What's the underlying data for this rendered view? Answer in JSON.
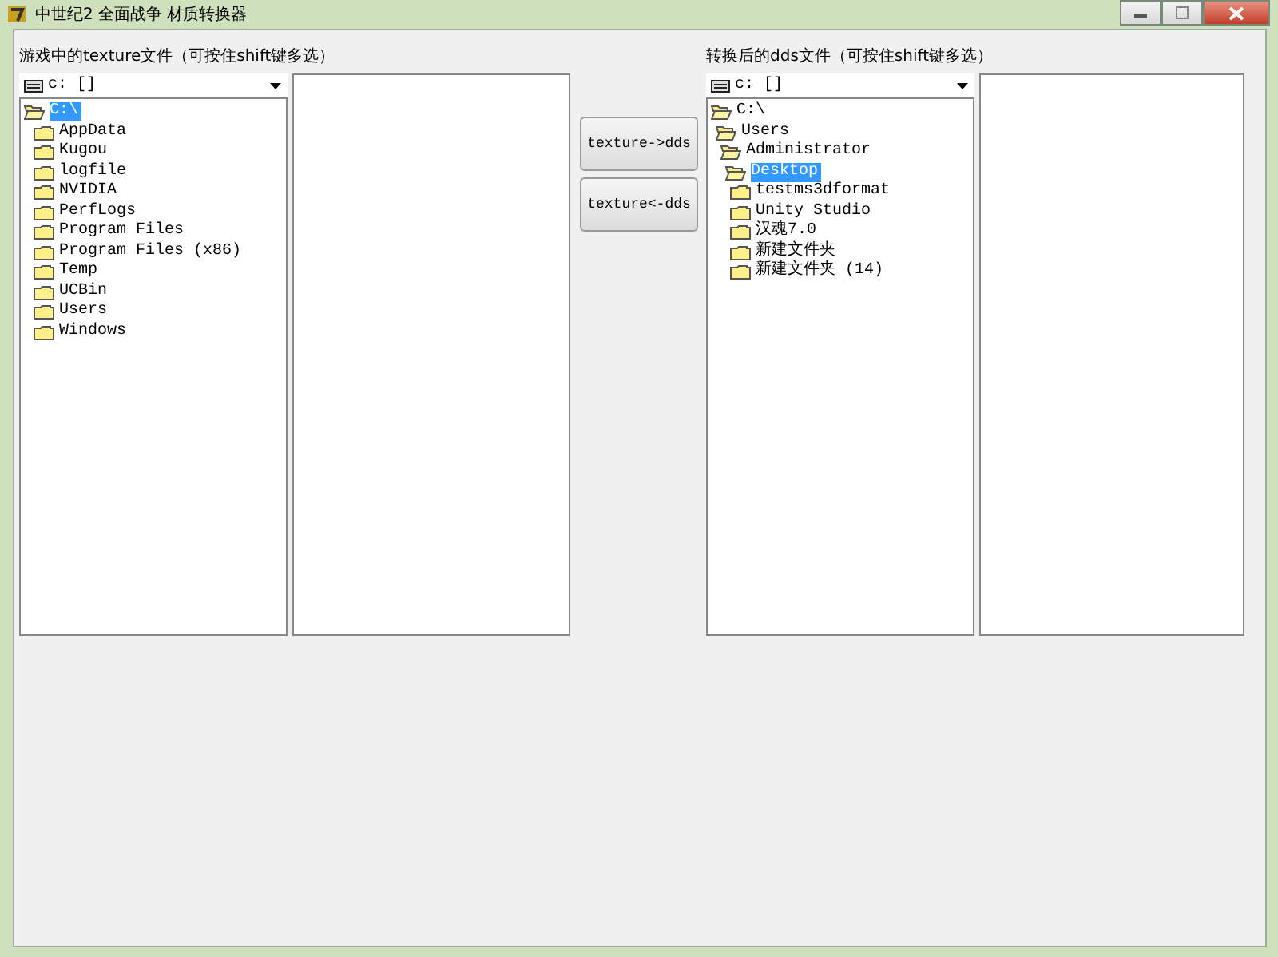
{
  "window": {
    "title": "中世纪2 全面战争 材质转换器"
  },
  "left": {
    "label": "游戏中的texture文件（可按住shift键多选）",
    "drive": "c: []",
    "tree": [
      {
        "name": "C:\\",
        "expanded": true,
        "selected": true,
        "children": [
          {
            "name": "AppData",
            "expanded": false,
            "selected": false
          },
          {
            "name": "Kugou",
            "expanded": false,
            "selected": false
          },
          {
            "name": "logfile",
            "expanded": false,
            "selected": false
          },
          {
            "name": "NVIDIA",
            "expanded": false,
            "selected": false
          },
          {
            "name": "PerfLogs",
            "expanded": false,
            "selected": false
          },
          {
            "name": "Program Files",
            "expanded": false,
            "selected": false
          },
          {
            "name": "Program Files (x86)",
            "expanded": false,
            "selected": false
          },
          {
            "name": "Temp",
            "expanded": false,
            "selected": false
          },
          {
            "name": "UCBin",
            "expanded": false,
            "selected": false
          },
          {
            "name": "Users",
            "expanded": false,
            "selected": false
          },
          {
            "name": "Windows",
            "expanded": false,
            "selected": false
          }
        ]
      }
    ]
  },
  "buttons": [
    "texture->dds",
    "texture<-dds"
  ],
  "right": {
    "label": "转换后的dds文件（可按住shift键多选）",
    "drive": "c: []",
    "tree": [
      {
        "name": "C:\\",
        "expanded": true,
        "selected": false,
        "children": [
          {
            "name": "Users",
            "expanded": true,
            "selected": false,
            "children": [
              {
                "name": "Administrator",
                "expanded": true,
                "selected": false,
                "children": [
                  {
                    "name": "Desktop",
                    "expanded": true,
                    "selected": true,
                    "children": [
                      {
                        "name": "testms3dformat",
                        "expanded": false,
                        "selected": false
                      },
                      {
                        "name": "Unity Studio",
                        "expanded": false,
                        "selected": false
                      },
                      {
                        "name": "汉魂7.0",
                        "expanded": false,
                        "selected": false
                      },
                      {
                        "name": "新建文件夹",
                        "expanded": false,
                        "selected": false
                      },
                      {
                        "name": "新建文件夹 (14)",
                        "expanded": false,
                        "selected": false
                      }
                    ]
                  }
                ]
              }
            ]
          }
        ]
      }
    ]
  }
}
